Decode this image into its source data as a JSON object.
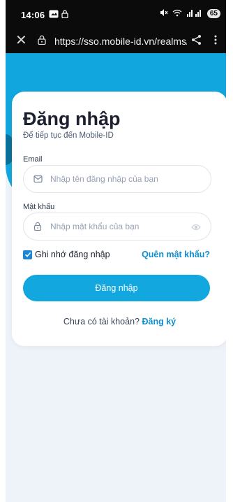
{
  "status_bar": {
    "time": "14:06",
    "battery": "65"
  },
  "browser": {
    "url": "https://sso.mobile-id.vn/realms/r"
  },
  "login": {
    "title": "Đăng nhập",
    "subtitle": "Để tiếp tục đến Mobile-ID",
    "email_label": "Email",
    "email_placeholder": "Nhập tên đăng nhập của bạn",
    "password_label": "Mật khẩu",
    "password_placeholder": "Nhập mật khẩu của bạn",
    "remember_label": "Ghi nhớ đăng nhập",
    "remember_checked": true,
    "forgot_label": "Quên mật khẩu?",
    "submit_label": "Đăng nhập",
    "no_account_text": "Chưa có tài khoản?",
    "signup_label": "Đăng ký"
  },
  "colors": {
    "primary": "#13a7df",
    "link": "#0f8fcd",
    "background": "#eef3fa",
    "text_dark": "#1b1f2e"
  },
  "icons": [
    "image-icon",
    "lock-status-icon",
    "mute-icon",
    "wifi-icon",
    "signal-icon",
    "close-icon",
    "lock-icon",
    "share-icon",
    "more-icon",
    "mail-icon",
    "password-lock-icon",
    "eye-icon",
    "checkmark-icon"
  ]
}
